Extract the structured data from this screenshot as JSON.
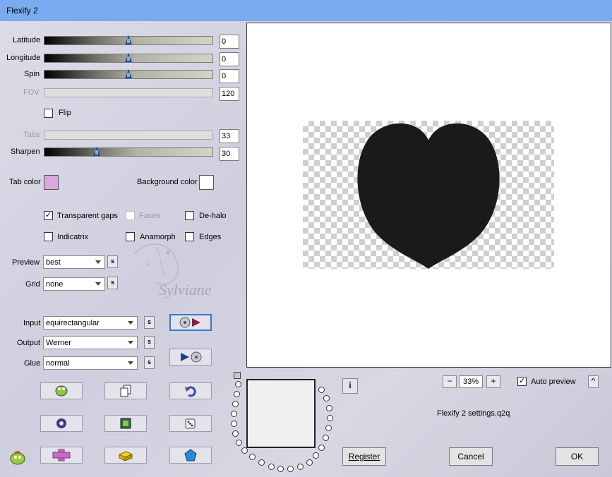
{
  "window": {
    "title": "Flexify 2"
  },
  "sliders": [
    {
      "label": "Latitude",
      "value": "0",
      "level": 0.5,
      "enabled": true
    },
    {
      "label": "Longitude",
      "value": "0",
      "level": 0.5,
      "enabled": true
    },
    {
      "label": "Spin",
      "value": "0",
      "level": 0.5,
      "enabled": true
    },
    {
      "label": "FOV",
      "value": "120",
      "enabled": false
    },
    {
      "label": "Tabs",
      "value": "33",
      "enabled": false
    },
    {
      "label": "Sharpen",
      "value": "30",
      "level": 0.3,
      "enabled": true
    }
  ],
  "flip": {
    "label": "Flip",
    "checked": false
  },
  "colors": {
    "tab_color_label": "Tab color",
    "tab_color": "#d8a8dc",
    "background_color_label": "Background color",
    "background_color": "#ffffff"
  },
  "options": {
    "transparent_gaps": {
      "label": "Transparent gaps",
      "checked": true
    },
    "faces": {
      "label": "Faces",
      "checked": false
    },
    "de_halo": {
      "label": "De-halo",
      "checked": false
    },
    "indicatrix": {
      "label": "Indicatrix",
      "checked": false
    },
    "anamorph": {
      "label": "Anamorph",
      "checked": false
    },
    "edges": {
      "label": "Edges",
      "checked": false
    }
  },
  "selects": {
    "preview": {
      "label": "Preview",
      "value": "best"
    },
    "grid": {
      "label": "Grid",
      "value": "none"
    },
    "input": {
      "label": "Input",
      "value": "equirectangular"
    },
    "output": {
      "label": "Output",
      "value": "Werner"
    },
    "glue": {
      "label": "Glue",
      "value": "normal"
    },
    "s_label": "s"
  },
  "zoom": {
    "minus": "−",
    "value": "33%",
    "plus": "+"
  },
  "auto_preview": {
    "label": "Auto preview",
    "checked": true
  },
  "settings_file": "Flexify 2 settings.q2q",
  "info_icon": "i",
  "watermark_text": "Sylviane",
  "buttons": {
    "register": "Register",
    "cancel": "Cancel",
    "ok": "OK",
    "collapse": "^"
  },
  "accent": "#1d4d8f"
}
